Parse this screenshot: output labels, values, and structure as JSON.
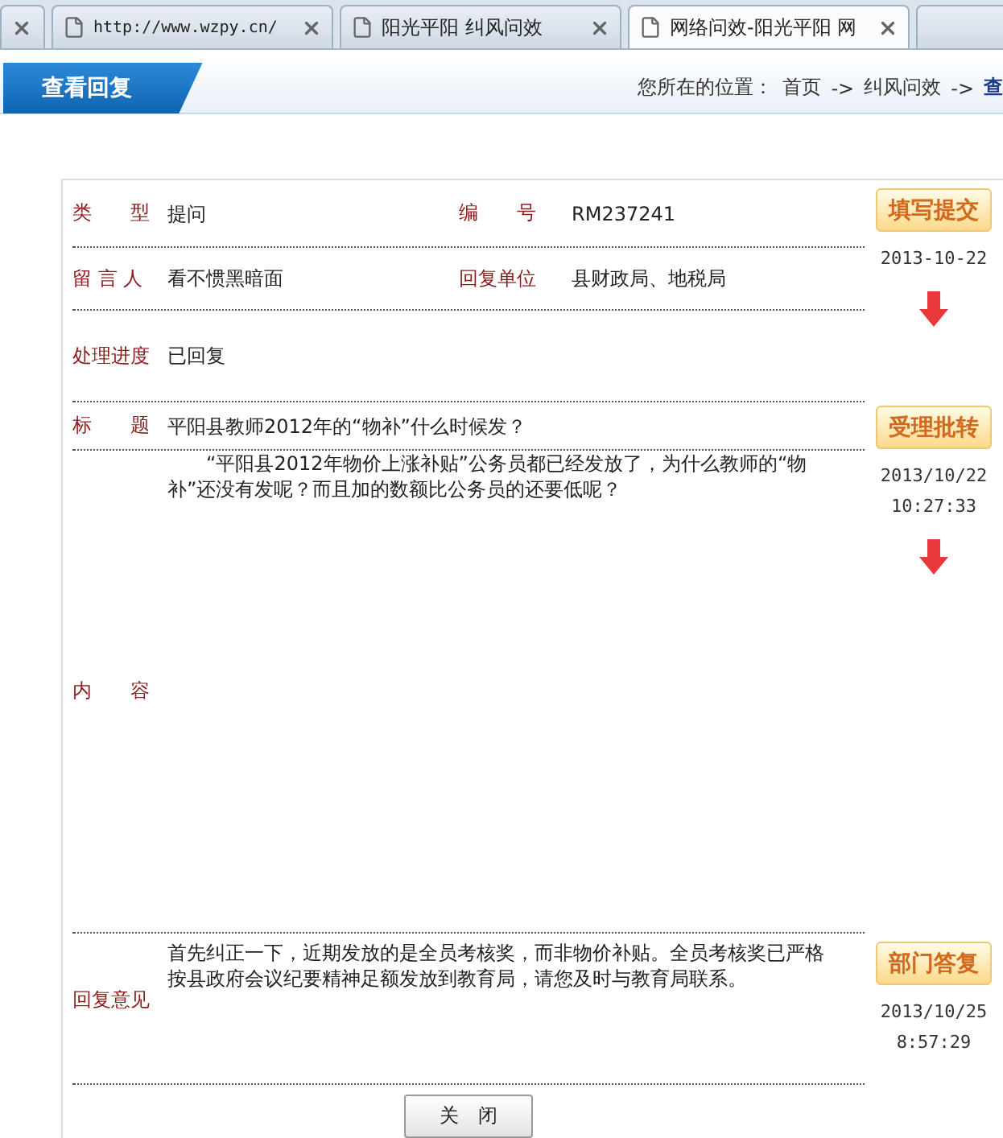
{
  "browser_tabs": [
    {
      "selected": false
    },
    {
      "label": "http://www.wzpy.cn/",
      "selected": false
    },
    {
      "label": "阳光平阳  纠风问效",
      "selected": false
    },
    {
      "label": "网络问效-阳光平阳  网",
      "selected": true
    }
  ],
  "header": {
    "title": "查看回复",
    "breadcrumb_prefix": "您所在的位置：",
    "separator": "->",
    "breadcrumb": [
      {
        "label": "首页",
        "current": false
      },
      {
        "label": "纠风问效",
        "current": false
      },
      {
        "label": "查",
        "current": true
      }
    ]
  },
  "rows": [
    {
      "kind": "info",
      "items": [
        {
          "label": "类　　型",
          "value": "提问"
        },
        {
          "label": "编　　号",
          "value": "RM237241"
        }
      ]
    },
    {
      "kind": "info",
      "items": [
        {
          "label": "留 言 人",
          "value": "看不惯黑暗面"
        },
        {
          "label": "回复单位",
          "value": "县财政局、地税局"
        }
      ]
    },
    {
      "kind": "progress",
      "items": [
        {
          "label": "处理进度",
          "value": "已回复"
        }
      ]
    },
    {
      "kind": "title",
      "items": [
        {
          "label": "标　　题",
          "value": "平阳县教师2012年的“物补”什么时候发？"
        }
      ]
    },
    {
      "kind": "content",
      "items": [
        {
          "label": "内　　容",
          "value": "“平阳县2012年物价上涨补贴”公务员都已经发放了，为什么教师的“物补”还没有发呢？而且加的数额比公务员的还要低呢？"
        }
      ]
    },
    {
      "kind": "reply",
      "items": [
        {
          "label": "回复意见",
          "value": "首先纠正一下，近期发放的是全员考核奖，而非物价补贴。全员考核奖已严格按县政府会议纪要精神足额发放到教育局，请您及时与教育局联系。"
        }
      ]
    }
  ],
  "close_button": "关　闭",
  "steps": [
    {
      "label": "填写提交",
      "date": "2013-10-22"
    },
    {
      "label": "受理批转",
      "date": "2013/10/22",
      "time": "10:27:33"
    },
    {
      "label": "部门答复",
      "date": "2013/10/25",
      "time": "8:57:29"
    }
  ]
}
